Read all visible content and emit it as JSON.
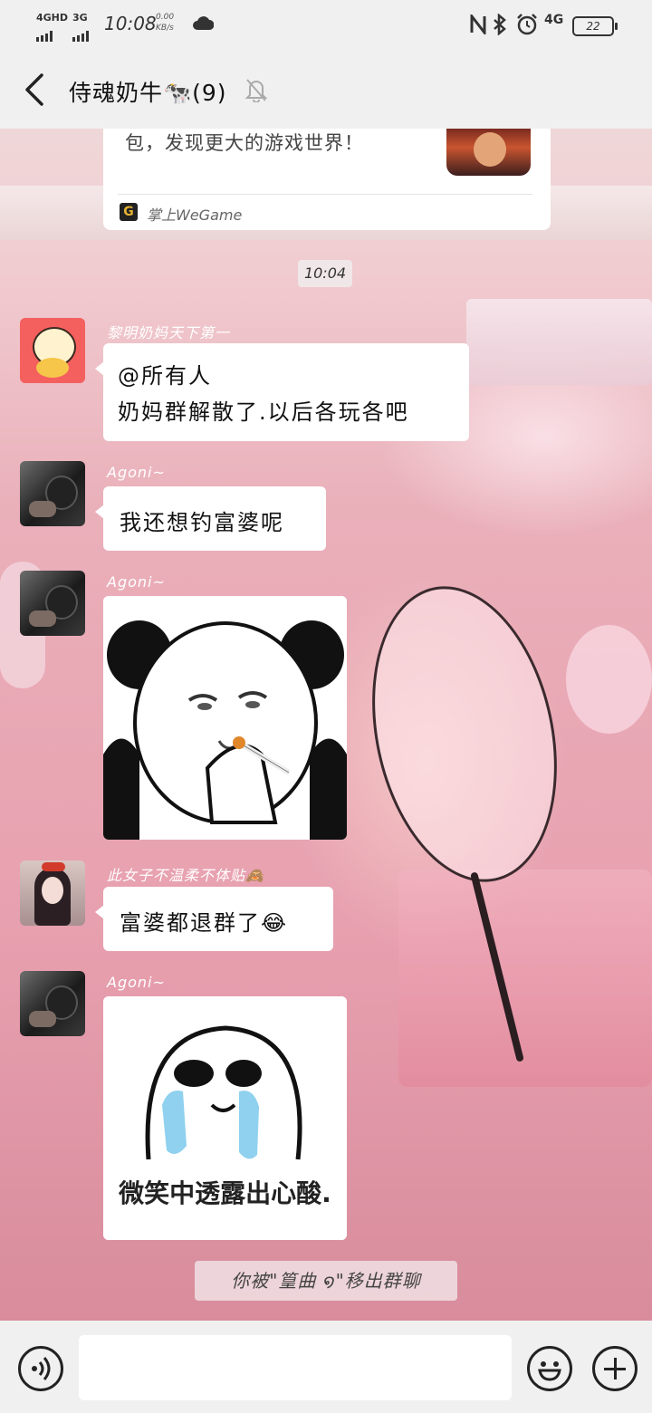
{
  "status_bar": {
    "network1": "4GHD",
    "network2": "3G",
    "time": "10:08",
    "rate_value": "0.00",
    "rate_unit": "KB/s",
    "net_right": "4G",
    "battery": "22"
  },
  "header": {
    "title": "侍魂奶牛🐄(9)",
    "back_icon": "chevron-left-icon",
    "mute_icon": "bell-off-icon"
  },
  "messages": {
    "card": {
      "text": "包，发现更大的游戏世界！",
      "source": "掌上WeGame",
      "source_icon_letter": "G"
    },
    "time_divider": "10:04",
    "m1": {
      "sender": "黎明奶妈天下第一",
      "line1": "@所有人",
      "line2": "奶妈群解散了.以后各玩各吧"
    },
    "m2": {
      "sender": "Agoni~",
      "text": "我还想钓富婆呢"
    },
    "m3": {
      "sender": "Agoni~",
      "sticker": "panda-smoking-meme"
    },
    "m4": {
      "sender": "此女子不温柔不体贴🙈",
      "text": "富婆都退群了😂"
    },
    "m5": {
      "sender": "Agoni~",
      "sticker_caption": "微笑中透露出心酸."
    },
    "system_notice": "你被\"篁曲    ໑\"移出群聊"
  },
  "bottom_bar": {
    "voice_icon": "voice-icon",
    "emoji_icon": "emoji-icon",
    "plus_icon": "plus-icon",
    "input_placeholder": ""
  },
  "colors": {
    "bar_bg": "#f0f0f0",
    "bubble_bg": "#ffffff",
    "text": "#111111"
  }
}
